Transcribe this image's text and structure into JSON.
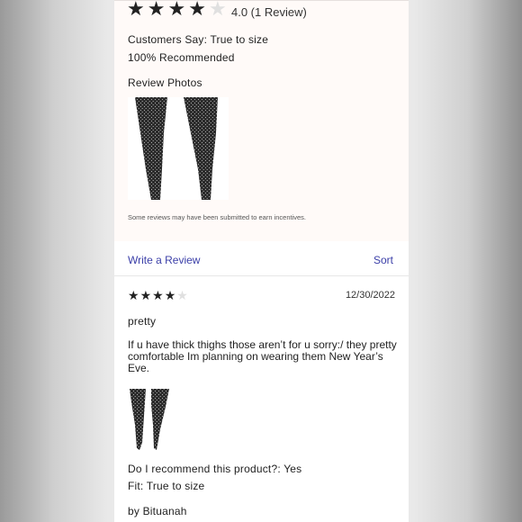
{
  "summary": {
    "star_count": 4,
    "star_max": 5,
    "rating_text": "4.0 (1 Review)",
    "customers_say": "Customers Say: True to size",
    "recommended": "100% Recommended",
    "photos_label": "Review Photos",
    "incentive_note": "Some reviews may have been submitted to earn incentives."
  },
  "actions": {
    "write_review": "Write a Review",
    "sort": "Sort"
  },
  "review": {
    "star_count": 4,
    "date": "12/30/2022",
    "title": "pretty",
    "body": "If u have thick thighs those aren’t for u sorry:/ they pretty comfortable Im planning on wearing them New Year’s Eve.",
    "recommend": "Do I recommend this product?: Yes",
    "fit": "Fit: True to size",
    "author": "by Bituanah"
  },
  "colors": {
    "link": "#3b3fa8",
    "star_filled": "#222222",
    "star_empty": "#e0e0e0"
  }
}
